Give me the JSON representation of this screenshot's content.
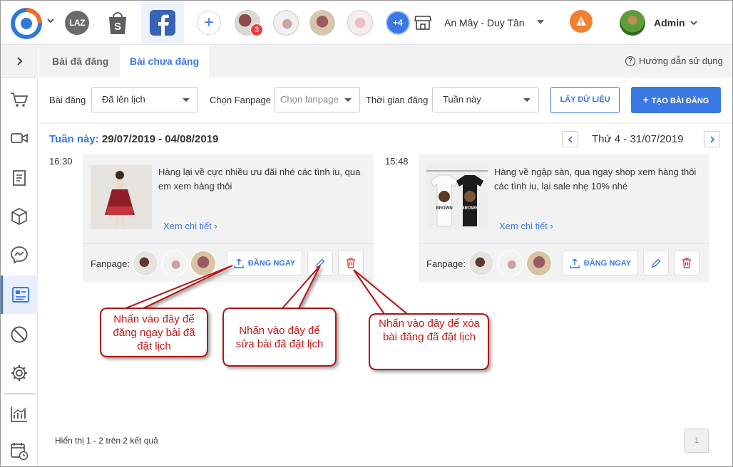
{
  "topbar": {
    "laz_label": "LAZ",
    "avatar_badge": "3",
    "more_accounts": "+4",
    "store_name": "An Mây - Duy Tân",
    "warning_label": "!",
    "admin_name": "Admin"
  },
  "tabs": [
    {
      "label": "Bài đã đăng"
    },
    {
      "label": "Bài chưa đăng"
    }
  ],
  "help_label": "Hướng dẫn sử dụng",
  "filters": {
    "post_label": "Bài đăng",
    "post_value": "Đã lên lịch",
    "fanpage_label": "Chọn Fanpage",
    "fanpage_placeholder": "Chọn fanpage",
    "time_label": "Thời gian đăng",
    "time_value": "Tuần này",
    "fetch_button": "LẤY DỮ LIỆU",
    "create_button": "TẠO BÀI ĐĂNG"
  },
  "week": {
    "label": "Tuần này:",
    "range": "29/07/2019 - 04/08/2019",
    "day": "Thứ 4 - 31/07/2019"
  },
  "posts": [
    {
      "time": "16:30",
      "text": "Hàng lại về cực nhiều ưu đãi nhé các tình iu, qua em xem hàng thôi",
      "detail": "Xem chi tiết",
      "fanpage_label": "Fanpage:",
      "post_now": "ĐĂNG NGAY"
    },
    {
      "time": "15:48",
      "text": "Hàng về ngập sàn, qua ngay shop xem hàng thôi các tình iu, lại sale nhẹ 10% nhé",
      "detail": "Xem chi tiết",
      "fanpage_label": "Fanpage:",
      "post_now": "ĐĂNG NGAY"
    }
  ],
  "thumb2_shirt_text": "BROWN",
  "results": "Hiển thị 1 - 2 trên 2 kết quả",
  "pagination": {
    "current": "1"
  },
  "callouts": {
    "post_now": "Nhấn vào đây để đăng ngay bài đã đặt lịch",
    "edit": "Nhấn vào đây để sửa bài đã đặt lịch",
    "delete": "Nhấn vào đây để xóa bài đăng đã đặt lịch"
  },
  "colors": {
    "accent": "#3a78e3",
    "callout_red": "#c01818",
    "delete_red": "#e0433f",
    "warning": "#f47f2f",
    "facebook": "#3a62b6"
  },
  "icons": {
    "logo": "app-logo-icon",
    "shopee": "shopping-bag-icon",
    "facebook": "facebook-icon",
    "store": "store-icon",
    "upload": "upload-icon",
    "edit": "pencil-icon",
    "delete": "trash-icon"
  }
}
